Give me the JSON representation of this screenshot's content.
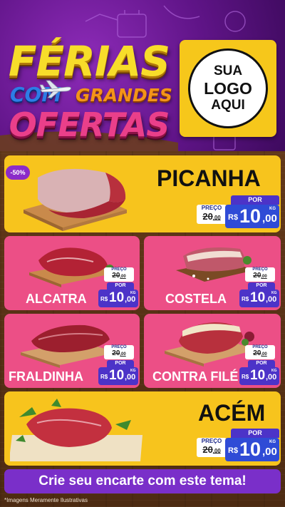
{
  "header": {
    "title_line1": "FÉRIAS",
    "title_line2a": "COM",
    "title_line2b": "GRANDES",
    "title_line3": "OFERTAS"
  },
  "logo": {
    "line1": "SUA",
    "line2": "LOGO",
    "line3": "AQUI"
  },
  "discount_badge": "-50%",
  "products": [
    {
      "name": "PICANHA",
      "por": "POR",
      "preco_label": "PREÇO",
      "old_int": "20",
      "old_dec": ",00",
      "currency": "R$",
      "price_int": "10",
      "price_dec": ",00",
      "unit": "KG"
    },
    {
      "name": "ALCATRA",
      "por": "POR",
      "preco_label": "PREÇO",
      "old_int": "20",
      "old_dec": ",00",
      "currency": "R$",
      "price_int": "10",
      "price_dec": ",00",
      "unit": "KG"
    },
    {
      "name": "COSTELA",
      "por": "POR",
      "preco_label": "PREÇO",
      "old_int": "20",
      "old_dec": ",00",
      "currency": "R$",
      "price_int": "10",
      "price_dec": ",00",
      "unit": "KG"
    },
    {
      "name": "FRALDINHA",
      "por": "POR",
      "preco_label": "PREÇO",
      "old_int": "20",
      "old_dec": ",00",
      "currency": "R$",
      "price_int": "10",
      "price_dec": ",00",
      "unit": "KG"
    },
    {
      "name": "CONTRA FILÉ",
      "por": "POR",
      "preco_label": "PREÇO",
      "old_int": "20",
      "old_dec": ",00",
      "currency": "R$",
      "price_int": "10",
      "price_dec": ",00",
      "unit": "KG"
    },
    {
      "name": "ACÉM",
      "por": "POR",
      "preco_label": "PREÇO",
      "old_int": "20",
      "old_dec": ",00",
      "currency": "R$",
      "price_int": "10",
      "price_dec": ",00",
      "unit": "KG"
    }
  ],
  "cta": "Crie seu encarte com este tema!",
  "disclaimer": "*Imagens Meramente Ilustrativas",
  "colors": {
    "yellow": "#f7c41d",
    "pink": "#ec4f86",
    "purple": "#7a2fc9",
    "price_blue": "#2f4bd6"
  }
}
